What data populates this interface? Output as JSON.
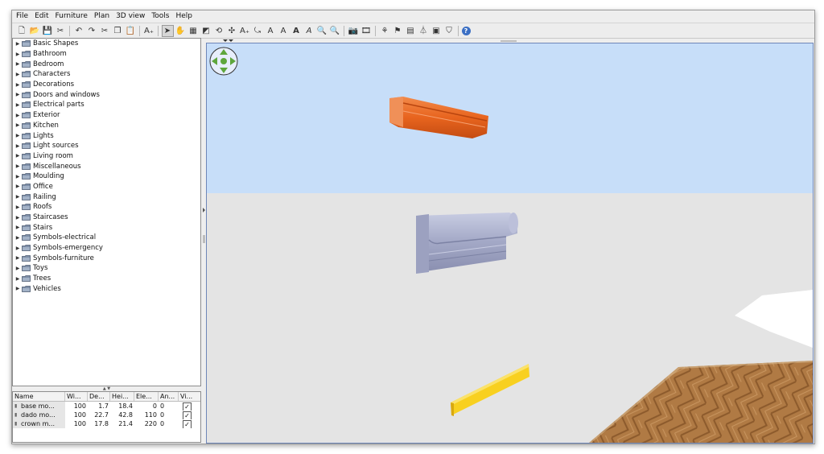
{
  "menubar": {
    "items": [
      {
        "label": "File"
      },
      {
        "label": "Edit"
      },
      {
        "label": "Furniture"
      },
      {
        "label": "Plan"
      },
      {
        "label": "3D view"
      },
      {
        "label": "Tools"
      },
      {
        "label": "Help"
      }
    ]
  },
  "toolbar": {
    "buttons": [
      {
        "icon": "new-file-icon",
        "glyph": "🗋"
      },
      {
        "icon": "open-folder-icon",
        "glyph": "📂"
      },
      {
        "icon": "save-icon",
        "glyph": "💾"
      },
      {
        "icon": "preferences-icon",
        "glyph": "✂"
      },
      {
        "icon": "undo-icon",
        "glyph": "↶"
      },
      {
        "icon": "redo-icon",
        "glyph": "↷"
      },
      {
        "icon": "cut-icon",
        "glyph": "✂"
      },
      {
        "icon": "copy-icon",
        "glyph": "❐"
      },
      {
        "icon": "paste-icon",
        "glyph": "📋"
      },
      {
        "icon": "add-furniture-icon",
        "glyph": "A₊"
      },
      {
        "icon": "select-icon",
        "glyph": "➤"
      },
      {
        "icon": "pan-icon",
        "glyph": "✋"
      },
      {
        "icon": "create-walls-icon",
        "glyph": "▦"
      },
      {
        "icon": "create-rooms-icon",
        "glyph": "◩"
      },
      {
        "icon": "create-polylines-icon",
        "glyph": "⟲"
      },
      {
        "icon": "create-dimensions-icon",
        "glyph": "✣"
      },
      {
        "icon": "add-text-icon",
        "glyph": "A₊"
      },
      {
        "icon": "rotate-text-icon",
        "glyph": "⤿"
      },
      {
        "icon": "increase-text-icon",
        "glyph": "A"
      },
      {
        "icon": "decrease-text-icon",
        "glyph": "A"
      },
      {
        "icon": "bold-text-icon",
        "glyph": "A"
      },
      {
        "icon": "italic-text-icon",
        "glyph": "A"
      },
      {
        "icon": "zoom-in-icon",
        "glyph": "🔍"
      },
      {
        "icon": "zoom-out-icon",
        "glyph": "🔍"
      },
      {
        "icon": "create-photo-icon",
        "glyph": "📷"
      },
      {
        "icon": "create-video-icon",
        "glyph": "🎞"
      },
      {
        "icon": "import-furniture-icon",
        "glyph": "⚘"
      },
      {
        "icon": "import-texture-icon",
        "glyph": "⚑"
      },
      {
        "icon": "import-background-icon",
        "glyph": "▤"
      },
      {
        "icon": "flip-icon",
        "glyph": "⏃"
      },
      {
        "icon": "group-icon",
        "glyph": "▣"
      },
      {
        "icon": "modify-icon",
        "glyph": "⛉"
      },
      {
        "icon": "help-icon",
        "glyph": "?"
      }
    ]
  },
  "catalog": {
    "categories": [
      {
        "label": "Basic Shapes"
      },
      {
        "label": "Bathroom"
      },
      {
        "label": "Bedroom"
      },
      {
        "label": "Characters"
      },
      {
        "label": "Decorations"
      },
      {
        "label": "Doors and windows"
      },
      {
        "label": "Electrical parts"
      },
      {
        "label": "Exterior"
      },
      {
        "label": "Kitchen"
      },
      {
        "label": "Lights"
      },
      {
        "label": "Light sources"
      },
      {
        "label": "Living room"
      },
      {
        "label": "Miscellaneous"
      },
      {
        "label": "Moulding"
      },
      {
        "label": "Office"
      },
      {
        "label": "Railing"
      },
      {
        "label": "Roofs"
      },
      {
        "label": "Staircases"
      },
      {
        "label": "Stairs"
      },
      {
        "label": "Symbols-electrical"
      },
      {
        "label": "Symbols-emergency"
      },
      {
        "label": "Symbols-furniture"
      },
      {
        "label": "Toys"
      },
      {
        "label": "Trees"
      },
      {
        "label": "Vehicles"
      }
    ]
  },
  "furniture_table": {
    "columns": [
      "Name",
      "Wi...",
      "De...",
      "Hei...",
      "Ele...",
      "An...",
      "Vi..."
    ],
    "rows": [
      {
        "name": "base mo...",
        "width": "100",
        "depth": "1.7",
        "height": "18.4",
        "elevation": "0",
        "angle": "0",
        "visible": "✓"
      },
      {
        "name": "dado mo...",
        "width": "100",
        "depth": "22.7",
        "height": "42.8",
        "elevation": "110",
        "angle": "0",
        "visible": "✓"
      },
      {
        "name": "crown m...",
        "width": "100",
        "depth": "17.8",
        "height": "21.4",
        "elevation": "220",
        "angle": "0",
        "visible": "✓"
      }
    ]
  },
  "view3d": {
    "colors": {
      "sky": "#c7def9",
      "ground": "#e4e4e4",
      "crown_moulding": "#f07030",
      "dado_moulding": "#a8acc8",
      "base_moulding": "#f8d020",
      "floor": "#b07a44"
    }
  }
}
